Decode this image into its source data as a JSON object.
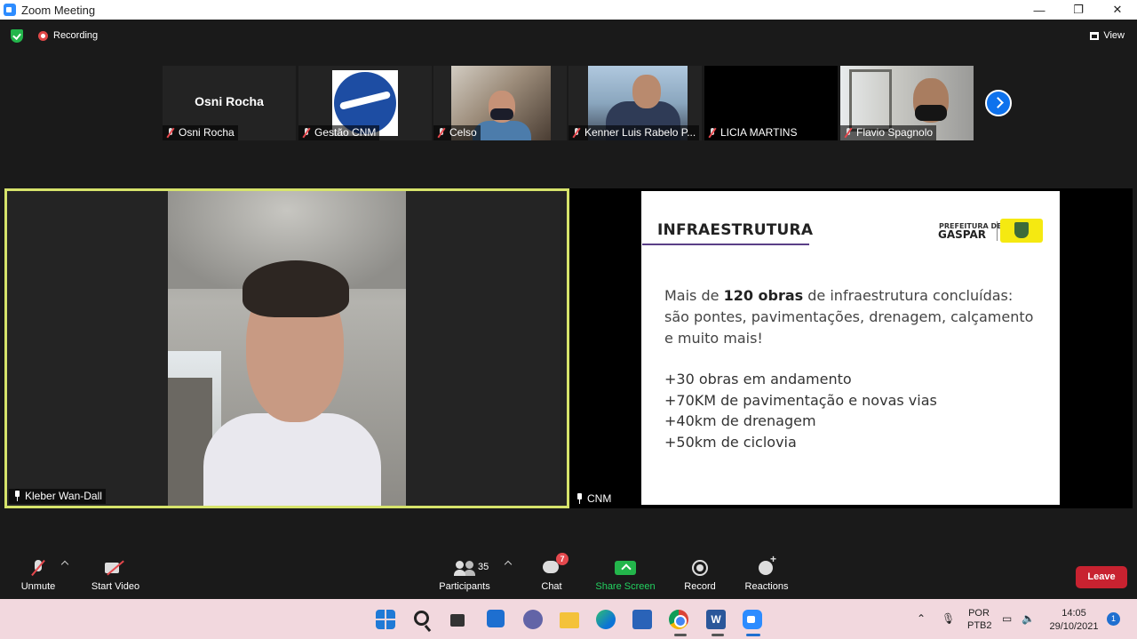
{
  "window": {
    "title": "Zoom Meeting",
    "minimize": "—",
    "restore": "❐",
    "close": "✕"
  },
  "topbar": {
    "recording_label": "Recording",
    "view_label": "View"
  },
  "thumbnails": [
    {
      "name": "Osni Rocha",
      "display_name": "Osni Rocha"
    },
    {
      "name": "Gestão CNM"
    },
    {
      "name": "Celso"
    },
    {
      "name": "Kenner Luis Rabelo P..."
    },
    {
      "name": "LICIA MARTINS"
    },
    {
      "name": "Flavio Spagnolo"
    }
  ],
  "speaker": {
    "name": "Kleber Wan-Dall"
  },
  "share": {
    "name": "CNM",
    "slide": {
      "heading": "INFRAESTRUTURA",
      "brand_top": "PREFEITURA DE",
      "brand_name": "GASPAR",
      "para_pre": "Mais de ",
      "para_bold": "120 obras",
      "para_post": " de infraestrutura concluídas: são pontes, pavimentações, drenagem, calçamento e muito mais!",
      "items": [
        "+30 obras em andamento",
        "+70KM de pavimentação e novas vias",
        "+40km de drenagem",
        "+50km de ciclovia"
      ]
    }
  },
  "toolbar": {
    "unmute": "Unmute",
    "start_video": "Start Video",
    "participants": "Participants",
    "participants_count": "35",
    "chat": "Chat",
    "chat_badge": "7",
    "share_screen": "Share Screen",
    "record": "Record",
    "reactions": "Reactions",
    "leave": "Leave"
  },
  "taskbar": {
    "word_letter": "W",
    "lang_1": "POR",
    "lang_2": "PTB2",
    "time": "14:05",
    "date": "29/10/2021",
    "notifications": "1"
  },
  "colors": {
    "active_speaker_border": "#d6e36b",
    "leave_button": "#c82230",
    "share_green": "#23b54b",
    "zoom_blue": "#2d8cff"
  }
}
